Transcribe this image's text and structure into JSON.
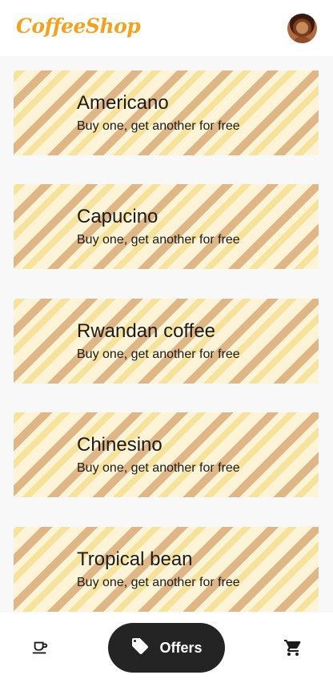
{
  "header": {
    "logo_text": "CoffeeShop",
    "avatar_icon": "user-avatar"
  },
  "offers": [
    {
      "title": "Americano",
      "subtitle": "Buy one, get another for free"
    },
    {
      "title": "Capucino",
      "subtitle": "Buy one, get another for free"
    },
    {
      "title": "Rwandan coffee",
      "subtitle": "Buy one, get another for free"
    },
    {
      "title": "Chinesino",
      "subtitle": "Buy one, get another for free"
    },
    {
      "title": "Tropical bean",
      "subtitle": "Buy one, get another for free"
    }
  ],
  "bottom_nav": {
    "coffee_icon": "coffee-cup-icon",
    "offers_label": "Offers",
    "offers_icon": "tag-icon",
    "cart_icon": "cart-icon",
    "active_bg": "#242424"
  },
  "colors": {
    "brand": "#f4a11d",
    "card_bg": "#fdf3d6",
    "stripe_light": "#f5e39b",
    "stripe_dark": "#dfb787"
  }
}
